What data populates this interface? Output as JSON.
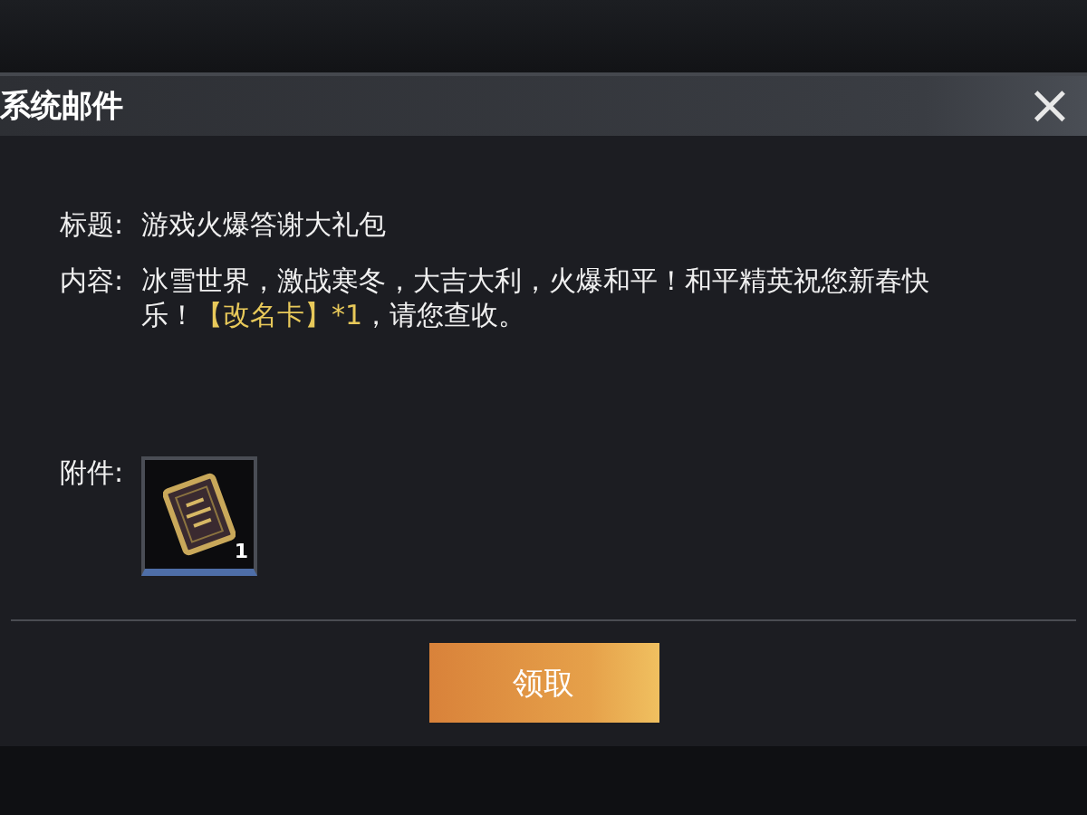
{
  "dialog": {
    "title": "系统邮件",
    "close": "×"
  },
  "subject": {
    "label": "标题:",
    "value": "游戏火爆答谢大礼包"
  },
  "content": {
    "label": "内容:",
    "parts": [
      {
        "text": "冰雪世界，激战寒冬，大吉大利，火爆和平！和平精英祝您新春快乐！",
        "highlight": false
      },
      {
        "text": "【改名卡】*1",
        "highlight": true
      },
      {
        "text": "，请您查收。",
        "highlight": false
      }
    ]
  },
  "attachments": {
    "label": "附件:",
    "items": [
      {
        "count": "1"
      }
    ]
  },
  "claim_button": "领取"
}
